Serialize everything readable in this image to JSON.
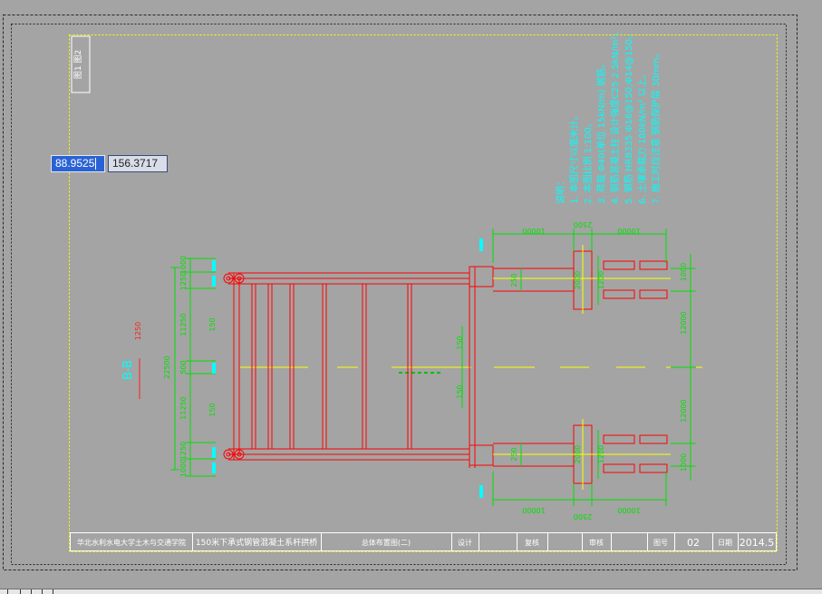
{
  "app": {
    "name": "AutoCAD drawing view"
  },
  "colors": {
    "background": "#a4a4a4",
    "frame": "#ffff00",
    "structure": "#ff0000",
    "dimension": "#00e000",
    "annotation": "#00ffff",
    "titleblock_text": "#ffffff"
  },
  "coordinate_input": {
    "x": "88.9525",
    "y": "156.3717"
  },
  "drawing": {
    "side_label": "图1 图2",
    "section_label": "B-B",
    "section_scale": "1250",
    "notes": {
      "heading": "说明：",
      "items": [
        "1. 本图尺寸以毫米计。",
        "2. 本图比例 1:100。",
        "3. 荷载 Φ40(单位 15kN/m) 钢筋。",
        "4. 钢筋混凝土柱 设计强度C25 2.5kN/m²。",
        "5. 钢筋 HRB335 Φ16@150,Φ14@150。",
        "6. 土壤承载力 180kN/m² 以上。",
        "7. 施工时应注意 钢筋保护层 30mm。"
      ]
    },
    "dims": {
      "left_total": "22500",
      "left_top_a": "1000",
      "left_top_b": "1250",
      "left_top_c": "11250",
      "left_mid": "500",
      "left_bot_c": "11250",
      "left_bot_b": "1250",
      "left_bot_a": "1000",
      "top_span_a": "10000",
      "top_span_b": "2500",
      "top_span_c": "10000",
      "bottom_span_a": "10000",
      "bottom_span_b": "2500",
      "bottom_span_c": "10000",
      "right_a": "1000",
      "right_b": "12000",
      "right_c": "12000",
      "right_d": "1000",
      "pier_top": "2000",
      "pier_bot": "2000",
      "small_a": "150",
      "small_b": "150",
      "small_c": "150",
      "small_d": "150",
      "inner_a": "1200",
      "inner_b": "1200",
      "gap_a": "250",
      "gap_b": "250"
    }
  },
  "title_block": {
    "school": "华北水利水电大学土木与交通学院",
    "project": "150米下承式钢管混凝土系杆拱桥",
    "drawing_name": "总体布置图(二)",
    "designer_label": "设计",
    "checker_label": "复核",
    "reviewer_label": "审核",
    "sheet_label": "图号",
    "sheet_no": "02",
    "date_label": "日期",
    "date": "2014.5"
  }
}
